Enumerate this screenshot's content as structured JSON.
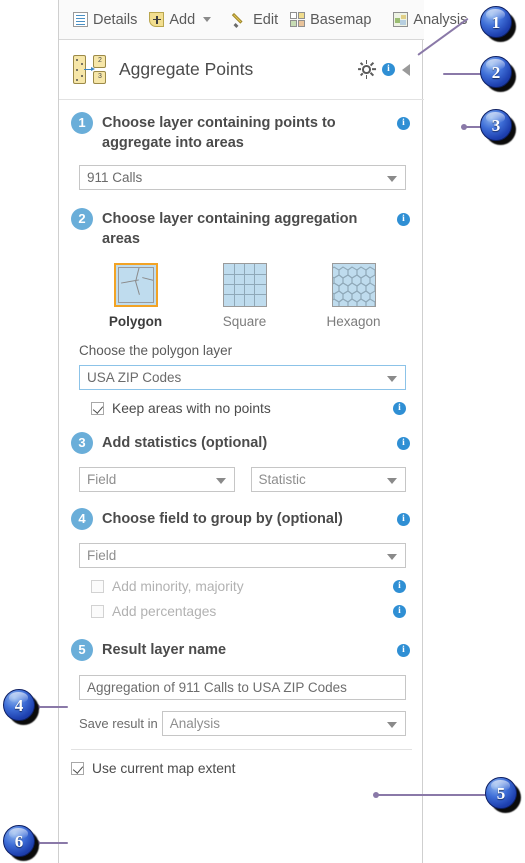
{
  "toolbar": {
    "items": [
      {
        "label": "Details",
        "icon": "details-icon"
      },
      {
        "label": "Add",
        "icon": "add-icon",
        "has_caret": true
      },
      {
        "label": "Edit",
        "icon": "edit-pencil-icon"
      },
      {
        "label": "Basemap",
        "icon": "basemap-icon"
      },
      {
        "label": "Analysis",
        "icon": "analysis-icon"
      }
    ]
  },
  "header": {
    "title": "Aggregate Points",
    "tool_icon": "aggregate-points-icon",
    "gear_icon": "gear-icon",
    "info_icon": "info-icon",
    "collapse_icon": "collapse-left-icon"
  },
  "steps": {
    "one": {
      "number": "1",
      "label": "Choose layer containing points to aggregate into areas",
      "layer_value": "911 Calls"
    },
    "two": {
      "number": "2",
      "label": "Choose layer containing aggregation areas",
      "geometry_options": [
        {
          "label": "Polygon",
          "icon": "polygon-shape-icon",
          "selected": true
        },
        {
          "label": "Square",
          "icon": "square-grid-icon",
          "selected": false
        },
        {
          "label": "Hexagon",
          "icon": "hexagon-grid-icon",
          "selected": false
        }
      ],
      "sub_label": "Choose the polygon layer",
      "polygon_layer_value": "USA ZIP Codes",
      "keep_areas_label": "Keep areas with no points",
      "keep_areas_checked": true
    },
    "three": {
      "number": "3",
      "label": "Add statistics (optional)",
      "field_placeholder": "Field",
      "statistic_placeholder": "Statistic"
    },
    "four": {
      "number": "4",
      "label": "Choose field to group by (optional)",
      "field_placeholder": "Field",
      "add_minority_label": "Add minority, majority",
      "add_minority_checked": false,
      "add_minority_disabled": true,
      "add_percentages_label": "Add percentages",
      "add_percentages_checked": false,
      "add_percentages_disabled": true
    },
    "five": {
      "number": "5",
      "label": "Result layer name",
      "result_name_value": "Aggregation of 911 Calls to USA ZIP Codes",
      "save_in_label": "Save result in",
      "save_in_value": "Analysis"
    },
    "six": {
      "use_extent_label": "Use current map extent",
      "use_extent_checked": true
    }
  },
  "callouts": [
    {
      "number": "1"
    },
    {
      "number": "2"
    },
    {
      "number": "3"
    },
    {
      "number": "4"
    },
    {
      "number": "5"
    },
    {
      "number": "6"
    }
  ],
  "colors": {
    "step_bullet": "#6aaed9",
    "info": "#2f8fd4",
    "selected_outline": "#f2a325",
    "callout_ball": "#1d3fae",
    "leader": "#8a79a8",
    "focus_border": "#8cc3e8"
  }
}
